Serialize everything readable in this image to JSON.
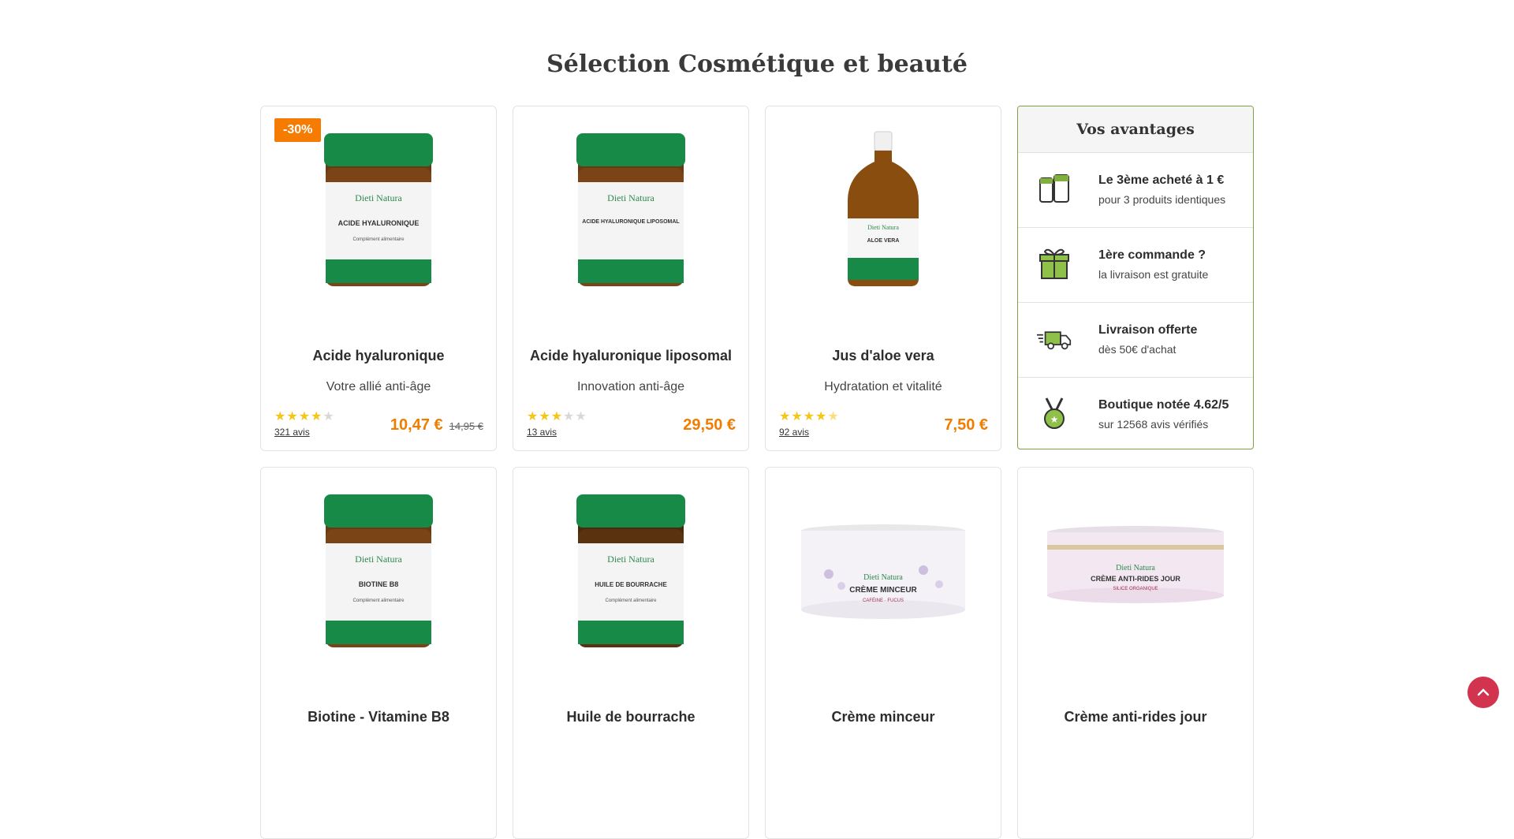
{
  "section": {
    "title": "Sélection Cosmétique et beauté"
  },
  "products": [
    {
      "name": "Acide hyaluronique",
      "subtitle": "Votre allié anti-âge",
      "badge": "-30%",
      "rating": 4,
      "reviews": "321 avis",
      "price": "10,47 €",
      "old_price": "14,95 €",
      "label": "ACIDE HYALURONIQUE"
    },
    {
      "name": "Acide hyaluronique liposomal",
      "subtitle": "Innovation anti-âge",
      "rating": 3,
      "reviews": "13 avis",
      "price": "29,50 €",
      "label": "ACIDE HYALURONIQUE LIPOSOMAL"
    },
    {
      "name": "Jus d'aloe vera",
      "subtitle": "Hydratation et vitalité",
      "rating": 4.5,
      "reviews": "92 avis",
      "price": "7,50 €",
      "label": "ALOE VERA"
    },
    {
      "name": "Biotine - Vitamine B8",
      "label": "BIOTINE B8"
    },
    {
      "name": "Huile de bourrache",
      "label": "HUILE DE BOURRACHE"
    },
    {
      "name": "Crème minceur",
      "label": "CRÈME MINCEUR",
      "label_sub": "CAFÉINE · FUCUS"
    },
    {
      "name": "Crème anti-rides jour",
      "label": "CRÈME ANTI-RIDES JOUR",
      "label_sub": "SILICE ORGANIQUE"
    }
  ],
  "brand": {
    "name": "Dieti Natura",
    "tagline": "Complément alimentaire"
  },
  "advantages": {
    "title": "Vos avantages",
    "items": [
      {
        "icon": "jars-icon",
        "title": "Le 3ème acheté à 1 €",
        "desc": "pour 3 produits identiques"
      },
      {
        "icon": "gift-icon",
        "title": "1ère commande ?",
        "desc": "la livraison est gratuite"
      },
      {
        "icon": "delivery-truck-icon",
        "title": "Livraison offerte",
        "desc": "dès 50€ d'achat"
      },
      {
        "icon": "medal-icon",
        "title": "Boutique notée 4.62/5",
        "desc": "sur 12568 avis vérifiés"
      }
    ]
  },
  "colors": {
    "accent": "#f07d00",
    "badge": "#f57c00",
    "brand_green": "#1b8a4a",
    "advantage_border": "#7fa046",
    "scroll_button": "#d2334f",
    "star": "#f5c518"
  }
}
